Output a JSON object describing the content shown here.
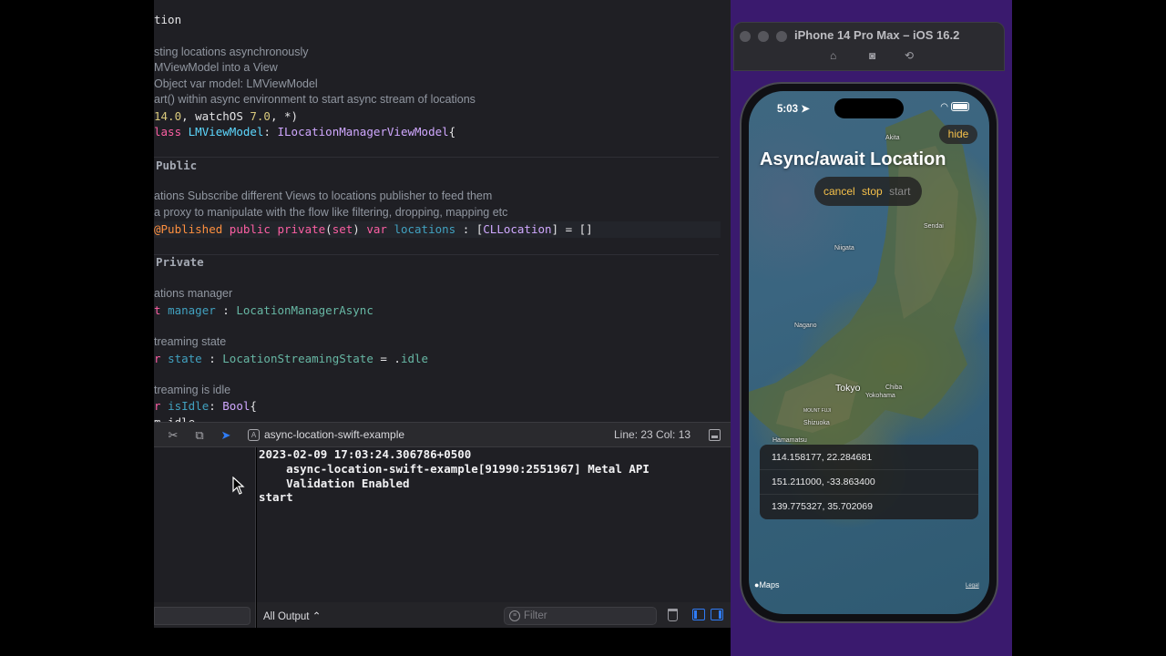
{
  "editor": {
    "lines": [
      {
        "kind": "code",
        "segments": [
          {
            "t": "tion",
            "c": "plain"
          }
        ]
      },
      {
        "kind": "comment",
        "text": "sting locations asynchronously"
      },
      {
        "kind": "comment",
        "text": "MViewModel into a View"
      },
      {
        "kind": "comment",
        "text": "Object var model: LMViewModel"
      },
      {
        "kind": "comment",
        "text": "art() within async environment to start async stream of locations"
      },
      {
        "kind": "code",
        "segments": [
          {
            "t": "14.0",
            "c": "num"
          },
          {
            "t": ", watchOS ",
            "c": "plain"
          },
          {
            "t": "7.0",
            "c": "num"
          },
          {
            "t": ", *)",
            "c": "plain"
          }
        ]
      },
      {
        "kind": "code",
        "segments": [
          {
            "t": "lass ",
            "c": "kw"
          },
          {
            "t": "LMViewModel",
            "c": "type2"
          },
          {
            "t": ": ",
            "c": "plain"
          },
          {
            "t": "ILocationManagerViewModel",
            "c": "type"
          },
          {
            "t": "{",
            "c": "plain"
          }
        ]
      },
      {
        "kind": "mark",
        "text": "Public"
      },
      {
        "kind": "comment",
        "text": "ations Subscribe different Views to locations publisher to feed them"
      },
      {
        "kind": "comment",
        "text": "a proxy to manipulate with the flow like filtering, dropping, mapping etc"
      },
      {
        "kind": "code",
        "segments": [
          {
            "t": "@Published ",
            "c": "attr"
          },
          {
            "t": "public private",
            "c": "kw"
          },
          {
            "t": "(",
            "c": "plain"
          },
          {
            "t": "set",
            "c": "kw"
          },
          {
            "t": ") ",
            "c": "plain"
          },
          {
            "t": "var ",
            "c": "kw"
          },
          {
            "t": "locations",
            "c": "var"
          },
          {
            "t": " : [",
            "c": "plain"
          },
          {
            "t": "CLLocation",
            "c": "type"
          },
          {
            "t": "] = []",
            "c": "plain"
          }
        ]
      },
      {
        "kind": "mark",
        "text": "Private"
      },
      {
        "kind": "comment",
        "text": "ations manager"
      },
      {
        "kind": "code",
        "segments": [
          {
            "t": "t ",
            "c": "kw"
          },
          {
            "t": "manager",
            "c": "var"
          },
          {
            "t": " : ",
            "c": "plain"
          },
          {
            "t": "LocationManagerAsync",
            "c": "prop"
          }
        ]
      },
      {
        "kind": "comment",
        "text": "treaming state"
      },
      {
        "kind": "code",
        "segments": [
          {
            "t": "r ",
            "c": "kw"
          },
          {
            "t": "state",
            "c": "var"
          },
          {
            "t": " : ",
            "c": "plain"
          },
          {
            "t": "LocationStreamingState",
            "c": "prop"
          },
          {
            "t": " = .",
            "c": "plain"
          },
          {
            "t": "idle",
            "c": "prop"
          }
        ]
      },
      {
        "kind": "comment",
        "text": "treaming is idle"
      },
      {
        "kind": "code",
        "segments": [
          {
            "t": "r ",
            "c": "kw"
          },
          {
            "t": "isIdle",
            "c": "var"
          },
          {
            "t": ": ",
            "c": "plain"
          },
          {
            "t": "Bool",
            "c": "type"
          },
          {
            "t": "{",
            "c": "plain"
          }
        ]
      },
      {
        "kind": "code",
        "segments": [
          {
            "t": "m.idle",
            "c": "plain"
          }
        ]
      }
    ]
  },
  "debug_bar": {
    "scheme": "async-location-swift-example",
    "cursor": "Line: 23  Col: 13"
  },
  "console": {
    "lines": [
      "2023-02-09 17:03:24.306786+0500",
      "    async-location-swift-example[91990:2551967] Metal API",
      "    Validation Enabled",
      "start"
    ],
    "output_select": "All Output ⌃",
    "filter_placeholder": "Filter"
  },
  "simulator": {
    "title": "iPhone 14 Pro Max – iOS 16.2"
  },
  "phone": {
    "time": "5:03",
    "hide": "hide",
    "title": "Async/await Location",
    "controls": {
      "cancel": "cancel",
      "stop": "stop",
      "start": "start"
    },
    "locations": [
      "114.158177, 22.284681",
      "151.211000, -33.863400",
      "139.775327, 35.702069"
    ],
    "maps": "Maps",
    "legal": "Legal",
    "map_labels": {
      "akita": "Akita",
      "sendai": "Sendai",
      "niigata": "Niigata",
      "nagano": "Nagano",
      "tokyo": "Tokyo",
      "yokohama": "Yokohama",
      "chiba": "Chiba",
      "shizuoka": "Shizuoka",
      "hamamatsu": "Hamamatsu",
      "mount_fuji": "MOUNT FUJI"
    }
  },
  "colors": {
    "accent_yellow": "#f5c04a",
    "xcode_blue": "#2f7cf6"
  }
}
